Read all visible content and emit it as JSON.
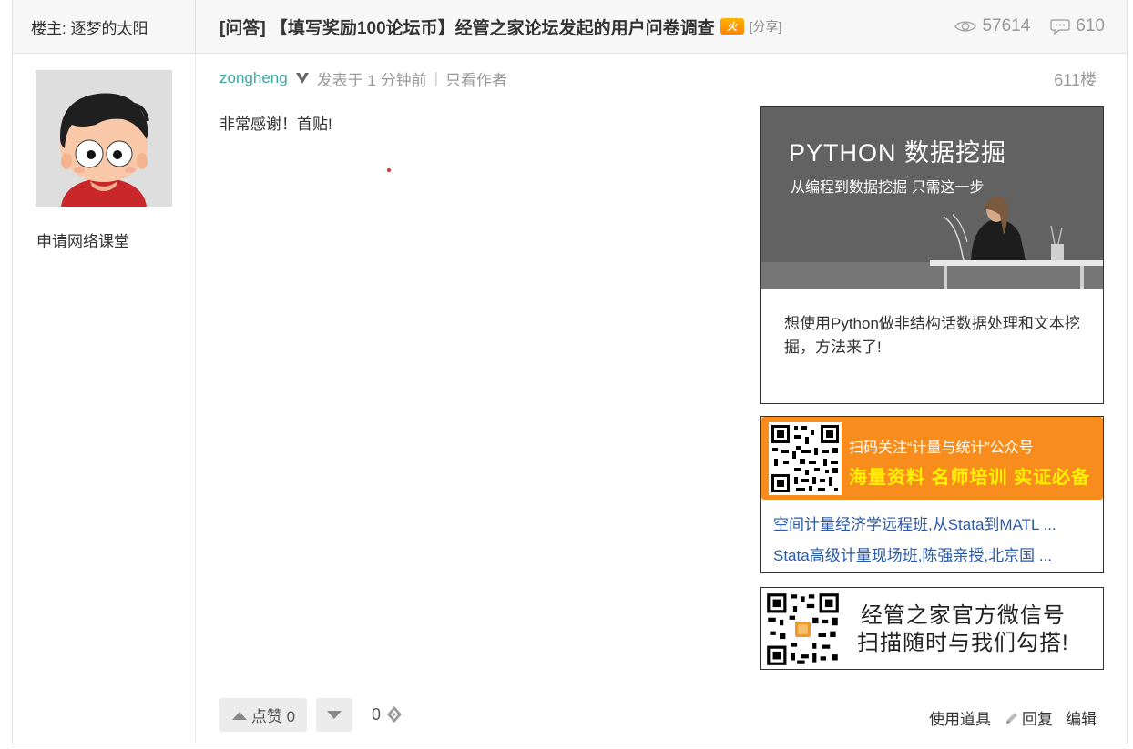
{
  "header": {
    "owner_label": "楼主: 逐梦的太阳",
    "title": "[问答] 【填写奖励100论坛币】经管之家论坛发起的用户问卷调查",
    "hot_badge": "火",
    "share_tag": "[分享]",
    "views": "57614",
    "replies": "610"
  },
  "user": {
    "link": "申请网络课堂"
  },
  "post": {
    "author": "zongheng",
    "posted": "发表于 1 分钟前",
    "only_author": "只看作者",
    "floor": "611楼",
    "body": "非常感谢！首贴!"
  },
  "ads": {
    "python": {
      "headline": "PYTHON 数据挖掘",
      "subline": "从编程到数据挖掘 只需这一步",
      "description": "想使用Python做非结构话数据处理和文本挖掘，方法来了!"
    },
    "wechat_banner": {
      "line1": "扫码关注“计量与统计”公众号",
      "line2": "海量资料 名师培训 实证必备"
    },
    "links": [
      "空间计量经济学远程班,从Stata到MATL ...",
      "Stata高级计量现场班,陈强亲授,北京国 ..."
    ],
    "official": {
      "line1": "经管之家官方微信号",
      "line2": "扫描随时与我们勾搭!"
    }
  },
  "footer": {
    "like_label": "点赞 0",
    "score": "0",
    "use_tool": "使用道具",
    "reply": "回复",
    "edit": "编辑"
  },
  "colors": {
    "author": "#3aa6a0",
    "banner_orange": "#f88d1d",
    "banner_yellow": "#fff200",
    "link_blue": "#2b5aa8"
  }
}
